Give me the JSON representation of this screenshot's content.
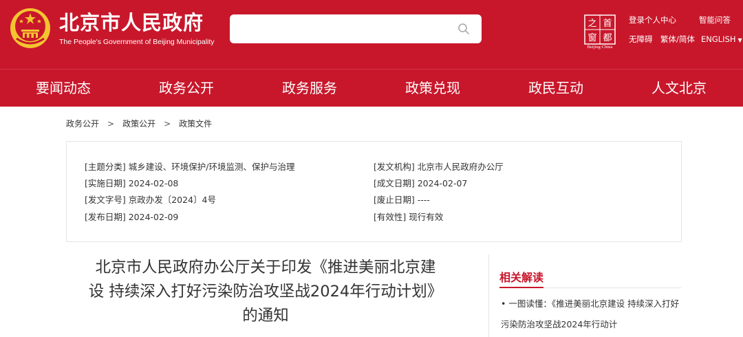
{
  "header": {
    "site_name_cn": "北京市人民政府",
    "site_name_en": "The People's Government of Beijing Municipality",
    "search_placeholder": "",
    "capital_logo_chars": [
      "之",
      "首",
      "窗",
      "都"
    ],
    "capital_logo_en": "Beijing·China",
    "links": {
      "login": "登录个人中心",
      "qa": "智能问答",
      "accessible": "无障碍",
      "trad_simp": "繁体/简体",
      "english": "ENGLISH"
    }
  },
  "nav": {
    "items": [
      "要闻动态",
      "政务公开",
      "政务服务",
      "政策兑现",
      "政民互动",
      "人文北京"
    ]
  },
  "breadcrumb": [
    "政务公开",
    "政策公开",
    "政策文件"
  ],
  "doc_info": {
    "topic": "[主题分类] 城乡建设、环境保护/环境监测、保护与治理",
    "issuer": "[发文机构] 北京市人民政府办公厅",
    "effective_date": "[实施日期] 2024-02-08",
    "written_date": "[成文日期] 2024-02-07",
    "doc_number": "[发文字号] 京政办发〔2024〕4号",
    "abolish_date": "[废止日期] ----",
    "publish_date": "[发布日期] 2024-02-09",
    "validity": "[有效性] 现行有效"
  },
  "article": {
    "title_lines": [
      "北京市人民政府办公厅关于印发《推进美丽北京建",
      "设 持续深入打好污染防治攻坚战2024年行动计划》",
      "的通知"
    ]
  },
  "related": {
    "heading": "相关解读",
    "items": [
      "• 一图读懂：《推进美丽北京建设 持续深入打好污染防治攻坚战2024年行动计"
    ]
  },
  "colors": {
    "brand_red": "#c8172b",
    "emblem_gold": "#f4c430",
    "text": "#333333"
  }
}
